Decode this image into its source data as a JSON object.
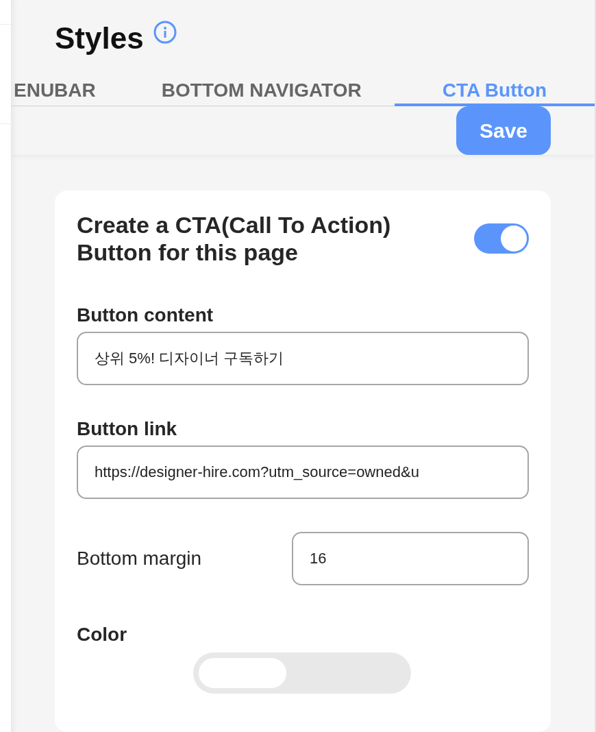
{
  "header": {
    "title": "Styles"
  },
  "tabs": [
    {
      "label": "ENUBAR",
      "selected": false
    },
    {
      "label": "BOTTOM NAVIGATOR",
      "selected": false
    },
    {
      "label": "CTA Button",
      "selected": true
    }
  ],
  "save_button": "Save",
  "cta": {
    "title": "Create a CTA(Call To Action) Button for this page",
    "enabled": true
  },
  "fields": [
    {
      "kind": "stacked",
      "label": "Button content",
      "value": "상위 5%! 디자이너 구독하기"
    },
    {
      "kind": "stacked",
      "label": "Button link",
      "value": "https://designer-hire.com?utm_source=owned&u"
    },
    {
      "kind": "inline",
      "label": "Bottom margin",
      "value": "16"
    }
  ],
  "color": {
    "label": "Color"
  }
}
